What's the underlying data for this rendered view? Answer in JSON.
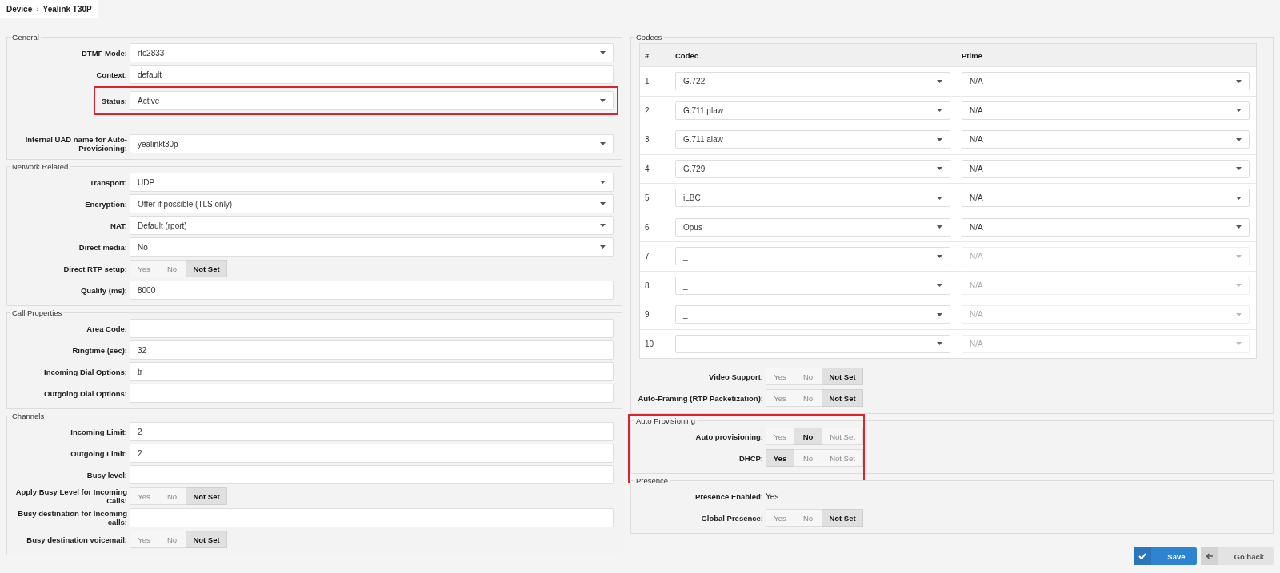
{
  "breadcrumb": {
    "items": [
      "Device",
      "Yealink T30P"
    ],
    "separator": "›"
  },
  "left_sections": [
    {
      "title": "General",
      "highlighted": false,
      "rows": [
        {
          "kind": "select",
          "label": "DTMF Mode:",
          "value": "rfc2833",
          "highlighted": false
        },
        {
          "kind": "input",
          "label": "Context:",
          "value": "default",
          "highlighted": false
        },
        {
          "kind": "select",
          "label": "Status:",
          "value": "Active",
          "highlighted": true
        },
        {
          "kind": "select",
          "label": "Internal UAD name for Auto-Provisioning:",
          "value": "yealinkt30p",
          "highlighted": false
        }
      ]
    },
    {
      "title": "Network Related",
      "highlighted": false,
      "rows": [
        {
          "kind": "select",
          "label": "Transport:",
          "value": "UDP"
        },
        {
          "kind": "select",
          "label": "Encryption:",
          "value": "Offer if possible (TLS only)"
        },
        {
          "kind": "select",
          "label": "NAT:",
          "value": "Default (rport)"
        },
        {
          "kind": "select",
          "label": "Direct media:",
          "value": "No"
        },
        {
          "kind": "toggle",
          "label": "Direct RTP setup:",
          "options": [
            {
              "label": "Yes",
              "selected": false
            },
            {
              "label": "No",
              "selected": false
            },
            {
              "label": "Not Set",
              "selected": true
            }
          ]
        },
        {
          "kind": "input",
          "label": "Qualify (ms):",
          "value": "8000"
        }
      ]
    },
    {
      "title": "Call Properties",
      "highlighted": false,
      "rows": [
        {
          "kind": "input",
          "label": "Area Code:"
        },
        {
          "kind": "input",
          "label": "Ringtime (sec):",
          "value": "32"
        },
        {
          "kind": "input",
          "label": "Incoming Dial Options:",
          "value": "tr"
        },
        {
          "kind": "input",
          "label": "Outgoing Dial Options:"
        }
      ]
    },
    {
      "title": "Channels",
      "highlighted": false,
      "rows": [
        {
          "kind": "input",
          "label": "Incoming Limit:",
          "value": "2"
        },
        {
          "kind": "input",
          "label": "Outgoing Limit:",
          "value": "2"
        },
        {
          "kind": "input",
          "label": "Busy level:"
        },
        {
          "kind": "toggle",
          "label": "Apply Busy Level for Incoming Calls:",
          "options": [
            {
              "label": "Yes",
              "selected": false
            },
            {
              "label": "No",
              "selected": false
            },
            {
              "label": "Not Set",
              "selected": true
            }
          ]
        },
        {
          "kind": "input",
          "label": "Busy destination for Incoming calls:"
        },
        {
          "kind": "toggle",
          "label": "Busy destination voicemail:",
          "options": [
            {
              "label": "Yes",
              "selected": false
            },
            {
              "label": "No",
              "selected": false
            },
            {
              "label": "Not Set",
              "selected": true
            }
          ]
        }
      ]
    }
  ],
  "codecs": {
    "title": "Codecs",
    "columns": [
      "#",
      "Codec",
      "Ptime"
    ],
    "rows": [
      {
        "number": "1",
        "codec": "G.722",
        "ptime": "N/A",
        "ptime_disabled": false
      },
      {
        "number": "2",
        "codec": "G.711 µlaw",
        "ptime": "N/A",
        "ptime_disabled": false
      },
      {
        "number": "3",
        "codec": "G.711 alaw",
        "ptime": "N/A",
        "ptime_disabled": false
      },
      {
        "number": "4",
        "codec": "G.729",
        "ptime": "N/A",
        "ptime_disabled": false
      },
      {
        "number": "5",
        "codec": "iLBC",
        "ptime": "N/A",
        "ptime_disabled": false
      },
      {
        "number": "6",
        "codec": "Opus",
        "ptime": "N/A",
        "ptime_disabled": false
      },
      {
        "number": "7",
        "codec": "_",
        "ptime": "N/A",
        "ptime_disabled": true
      },
      {
        "number": "8",
        "codec": "_",
        "ptime": "N/A",
        "ptime_disabled": true
      },
      {
        "number": "9",
        "codec": "_",
        "ptime": "N/A",
        "ptime_disabled": true
      },
      {
        "number": "10",
        "codec": "_",
        "ptime": "N/A",
        "ptime_disabled": true
      }
    ],
    "rows_after": [
      {
        "kind": "toggle",
        "label": "Video Support:",
        "options": [
          {
            "label": "Yes",
            "selected": false
          },
          {
            "label": "No",
            "selected": false
          },
          {
            "label": "Not Set",
            "selected": true
          }
        ]
      },
      {
        "kind": "toggle",
        "label": "Auto-Framing (RTP Packetization):",
        "options": [
          {
            "label": "Yes",
            "selected": false
          },
          {
            "label": "No",
            "selected": false
          },
          {
            "label": "Not Set",
            "selected": true
          }
        ]
      }
    ]
  },
  "right_sections": [
    {
      "title": "Auto Provisioning",
      "highlighted": true,
      "rows": [
        {
          "kind": "toggle",
          "label": "Auto provisioning:",
          "options": [
            {
              "label": "Yes",
              "selected": false
            },
            {
              "label": "No",
              "selected": true
            },
            {
              "label": "Not Set",
              "selected": false
            }
          ]
        },
        {
          "kind": "toggle",
          "label": "DHCP:",
          "options": [
            {
              "label": "Yes",
              "selected": true
            },
            {
              "label": "No",
              "selected": false
            },
            {
              "label": "Not Set",
              "selected": false
            }
          ]
        }
      ]
    },
    {
      "title": "Presence",
      "highlighted": false,
      "rows": [
        {
          "kind": "text",
          "label": "Presence Enabled:",
          "value": "Yes"
        },
        {
          "kind": "toggle",
          "label": "Global Presence:",
          "options": [
            {
              "label": "Yes",
              "selected": false
            },
            {
              "label": "No",
              "selected": false
            },
            {
              "label": "Not Set",
              "selected": true
            }
          ]
        }
      ]
    }
  ],
  "buttons": [
    {
      "kind": "save",
      "label": "Save"
    },
    {
      "kind": "back",
      "label": "Go back"
    }
  ]
}
